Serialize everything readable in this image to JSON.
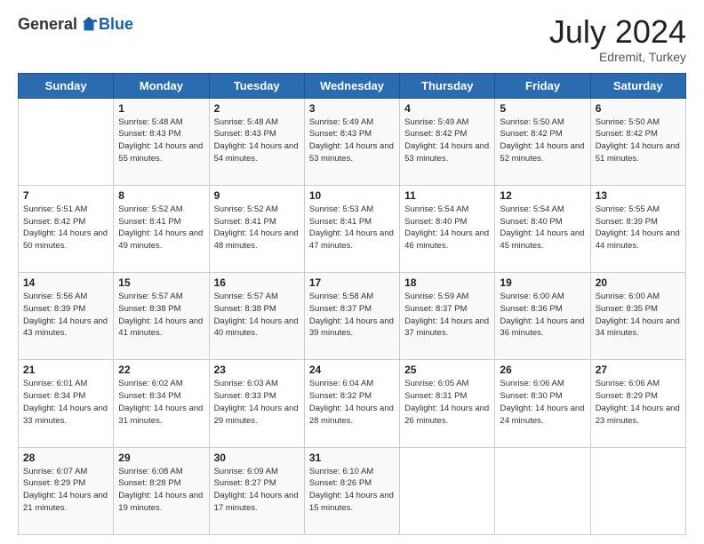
{
  "header": {
    "logo": {
      "general": "General",
      "blue": "Blue"
    },
    "title": "July 2024",
    "location": "Edremit, Turkey"
  },
  "calendar": {
    "days_of_week": [
      "Sunday",
      "Monday",
      "Tuesday",
      "Wednesday",
      "Thursday",
      "Friday",
      "Saturday"
    ],
    "weeks": [
      [
        {
          "day": "",
          "sunrise": "",
          "sunset": "",
          "daylight": ""
        },
        {
          "day": "1",
          "sunrise": "Sunrise: 5:48 AM",
          "sunset": "Sunset: 8:43 PM",
          "daylight": "Daylight: 14 hours and 55 minutes."
        },
        {
          "day": "2",
          "sunrise": "Sunrise: 5:48 AM",
          "sunset": "Sunset: 8:43 PM",
          "daylight": "Daylight: 14 hours and 54 minutes."
        },
        {
          "day": "3",
          "sunrise": "Sunrise: 5:49 AM",
          "sunset": "Sunset: 8:43 PM",
          "daylight": "Daylight: 14 hours and 53 minutes."
        },
        {
          "day": "4",
          "sunrise": "Sunrise: 5:49 AM",
          "sunset": "Sunset: 8:42 PM",
          "daylight": "Daylight: 14 hours and 53 minutes."
        },
        {
          "day": "5",
          "sunrise": "Sunrise: 5:50 AM",
          "sunset": "Sunset: 8:42 PM",
          "daylight": "Daylight: 14 hours and 52 minutes."
        },
        {
          "day": "6",
          "sunrise": "Sunrise: 5:50 AM",
          "sunset": "Sunset: 8:42 PM",
          "daylight": "Daylight: 14 hours and 51 minutes."
        }
      ],
      [
        {
          "day": "7",
          "sunrise": "Sunrise: 5:51 AM",
          "sunset": "Sunset: 8:42 PM",
          "daylight": "Daylight: 14 hours and 50 minutes."
        },
        {
          "day": "8",
          "sunrise": "Sunrise: 5:52 AM",
          "sunset": "Sunset: 8:41 PM",
          "daylight": "Daylight: 14 hours and 49 minutes."
        },
        {
          "day": "9",
          "sunrise": "Sunrise: 5:52 AM",
          "sunset": "Sunset: 8:41 PM",
          "daylight": "Daylight: 14 hours and 48 minutes."
        },
        {
          "day": "10",
          "sunrise": "Sunrise: 5:53 AM",
          "sunset": "Sunset: 8:41 PM",
          "daylight": "Daylight: 14 hours and 47 minutes."
        },
        {
          "day": "11",
          "sunrise": "Sunrise: 5:54 AM",
          "sunset": "Sunset: 8:40 PM",
          "daylight": "Daylight: 14 hours and 46 minutes."
        },
        {
          "day": "12",
          "sunrise": "Sunrise: 5:54 AM",
          "sunset": "Sunset: 8:40 PM",
          "daylight": "Daylight: 14 hours and 45 minutes."
        },
        {
          "day": "13",
          "sunrise": "Sunrise: 5:55 AM",
          "sunset": "Sunset: 8:39 PM",
          "daylight": "Daylight: 14 hours and 44 minutes."
        }
      ],
      [
        {
          "day": "14",
          "sunrise": "Sunrise: 5:56 AM",
          "sunset": "Sunset: 8:39 PM",
          "daylight": "Daylight: 14 hours and 43 minutes."
        },
        {
          "day": "15",
          "sunrise": "Sunrise: 5:57 AM",
          "sunset": "Sunset: 8:38 PM",
          "daylight": "Daylight: 14 hours and 41 minutes."
        },
        {
          "day": "16",
          "sunrise": "Sunrise: 5:57 AM",
          "sunset": "Sunset: 8:38 PM",
          "daylight": "Daylight: 14 hours and 40 minutes."
        },
        {
          "day": "17",
          "sunrise": "Sunrise: 5:58 AM",
          "sunset": "Sunset: 8:37 PM",
          "daylight": "Daylight: 14 hours and 39 minutes."
        },
        {
          "day": "18",
          "sunrise": "Sunrise: 5:59 AM",
          "sunset": "Sunset: 8:37 PM",
          "daylight": "Daylight: 14 hours and 37 minutes."
        },
        {
          "day": "19",
          "sunrise": "Sunrise: 6:00 AM",
          "sunset": "Sunset: 8:36 PM",
          "daylight": "Daylight: 14 hours and 36 minutes."
        },
        {
          "day": "20",
          "sunrise": "Sunrise: 6:00 AM",
          "sunset": "Sunset: 8:35 PM",
          "daylight": "Daylight: 14 hours and 34 minutes."
        }
      ],
      [
        {
          "day": "21",
          "sunrise": "Sunrise: 6:01 AM",
          "sunset": "Sunset: 8:34 PM",
          "daylight": "Daylight: 14 hours and 33 minutes."
        },
        {
          "day": "22",
          "sunrise": "Sunrise: 6:02 AM",
          "sunset": "Sunset: 8:34 PM",
          "daylight": "Daylight: 14 hours and 31 minutes."
        },
        {
          "day": "23",
          "sunrise": "Sunrise: 6:03 AM",
          "sunset": "Sunset: 8:33 PM",
          "daylight": "Daylight: 14 hours and 29 minutes."
        },
        {
          "day": "24",
          "sunrise": "Sunrise: 6:04 AM",
          "sunset": "Sunset: 8:32 PM",
          "daylight": "Daylight: 14 hours and 28 minutes."
        },
        {
          "day": "25",
          "sunrise": "Sunrise: 6:05 AM",
          "sunset": "Sunset: 8:31 PM",
          "daylight": "Daylight: 14 hours and 26 minutes."
        },
        {
          "day": "26",
          "sunrise": "Sunrise: 6:06 AM",
          "sunset": "Sunset: 8:30 PM",
          "daylight": "Daylight: 14 hours and 24 minutes."
        },
        {
          "day": "27",
          "sunrise": "Sunrise: 6:06 AM",
          "sunset": "Sunset: 8:29 PM",
          "daylight": "Daylight: 14 hours and 23 minutes."
        }
      ],
      [
        {
          "day": "28",
          "sunrise": "Sunrise: 6:07 AM",
          "sunset": "Sunset: 8:29 PM",
          "daylight": "Daylight: 14 hours and 21 minutes."
        },
        {
          "day": "29",
          "sunrise": "Sunrise: 6:08 AM",
          "sunset": "Sunset: 8:28 PM",
          "daylight": "Daylight: 14 hours and 19 minutes."
        },
        {
          "day": "30",
          "sunrise": "Sunrise: 6:09 AM",
          "sunset": "Sunset: 8:27 PM",
          "daylight": "Daylight: 14 hours and 17 minutes."
        },
        {
          "day": "31",
          "sunrise": "Sunrise: 6:10 AM",
          "sunset": "Sunset: 8:26 PM",
          "daylight": "Daylight: 14 hours and 15 minutes."
        },
        {
          "day": "",
          "sunrise": "",
          "sunset": "",
          "daylight": ""
        },
        {
          "day": "",
          "sunrise": "",
          "sunset": "",
          "daylight": ""
        },
        {
          "day": "",
          "sunrise": "",
          "sunset": "",
          "daylight": ""
        }
      ]
    ]
  }
}
